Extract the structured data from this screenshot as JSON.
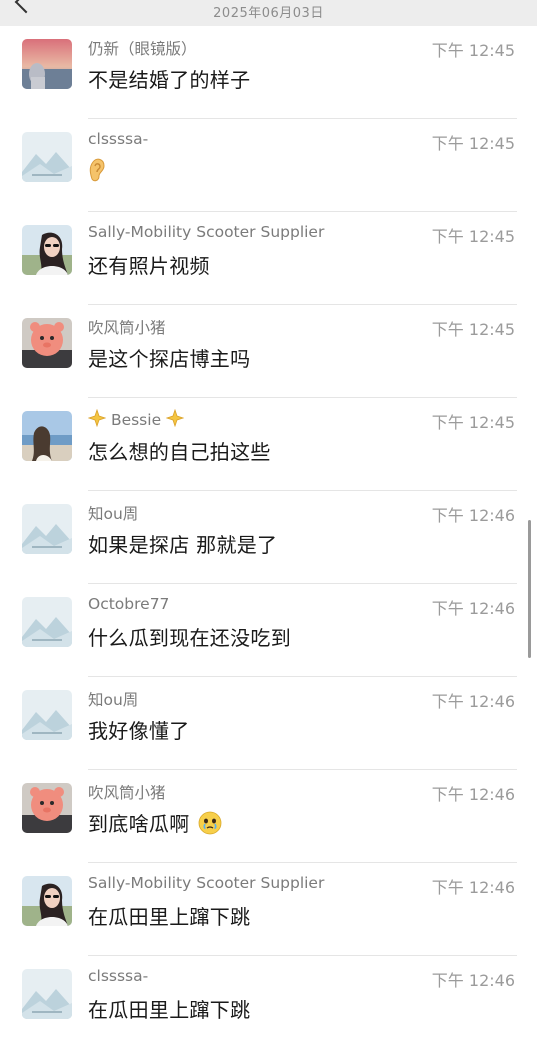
{
  "header": {
    "date": "2025年06月03日"
  },
  "messages": [
    {
      "name": "仍新（眼镜版）",
      "time": "下午 12:45",
      "text": "不是结婚了的样子",
      "avatar": "sky-photo-avatar"
    },
    {
      "name": "clssssa-",
      "time": "下午 12:45",
      "text": "",
      "emoji": "ear-emoji",
      "avatar": "default-mountain-avatar"
    },
    {
      "name": "Sally-Mobility Scooter Supplier",
      "time": "下午 12:45",
      "text": "还有照片视频",
      "avatar": "woman-sunglasses-avatar"
    },
    {
      "name": "吹风筒小猪",
      "time": "下午 12:45",
      "text": "是这个探店博主吗",
      "avatar": "pink-plush-avatar"
    },
    {
      "name": "Bessie",
      "time": "下午 12:45",
      "text": "怎么想的自己拍这些",
      "avatar": "beach-photo-avatar",
      "name_decoration": "sparkle-emoji"
    },
    {
      "name": "知ou周",
      "time": "下午 12:46",
      "text": "如果是探店 那就是了",
      "avatar": "default-mountain-avatar"
    },
    {
      "name": "Octobre77",
      "time": "下午 12:46",
      "text": "什么瓜到现在还没吃到",
      "avatar": "default-mountain-avatar"
    },
    {
      "name": "知ou周",
      "time": "下午 12:46",
      "text": "我好像懂了",
      "avatar": "default-mountain-avatar"
    },
    {
      "name": "吹风筒小猪",
      "time": "下午 12:46",
      "text": "到底啥瓜啊",
      "emoji": "teary-face-emoji",
      "avatar": "pink-plush-avatar"
    },
    {
      "name": "Sally-Mobility Scooter Supplier",
      "time": "下午 12:46",
      "text": "在瓜田里上蹿下跳",
      "avatar": "woman-sunglasses-avatar"
    },
    {
      "name": "clssssa-",
      "time": "下午 12:46",
      "text": "在瓜田里上蹿下跳",
      "avatar": "default-mountain-avatar"
    }
  ],
  "colors": {
    "header_bg": "#ededed",
    "divider": "#e5e5e5",
    "name_text": "#7b7b7b",
    "time_text": "#9b9b9b",
    "message_text": "#1a1a1a"
  }
}
